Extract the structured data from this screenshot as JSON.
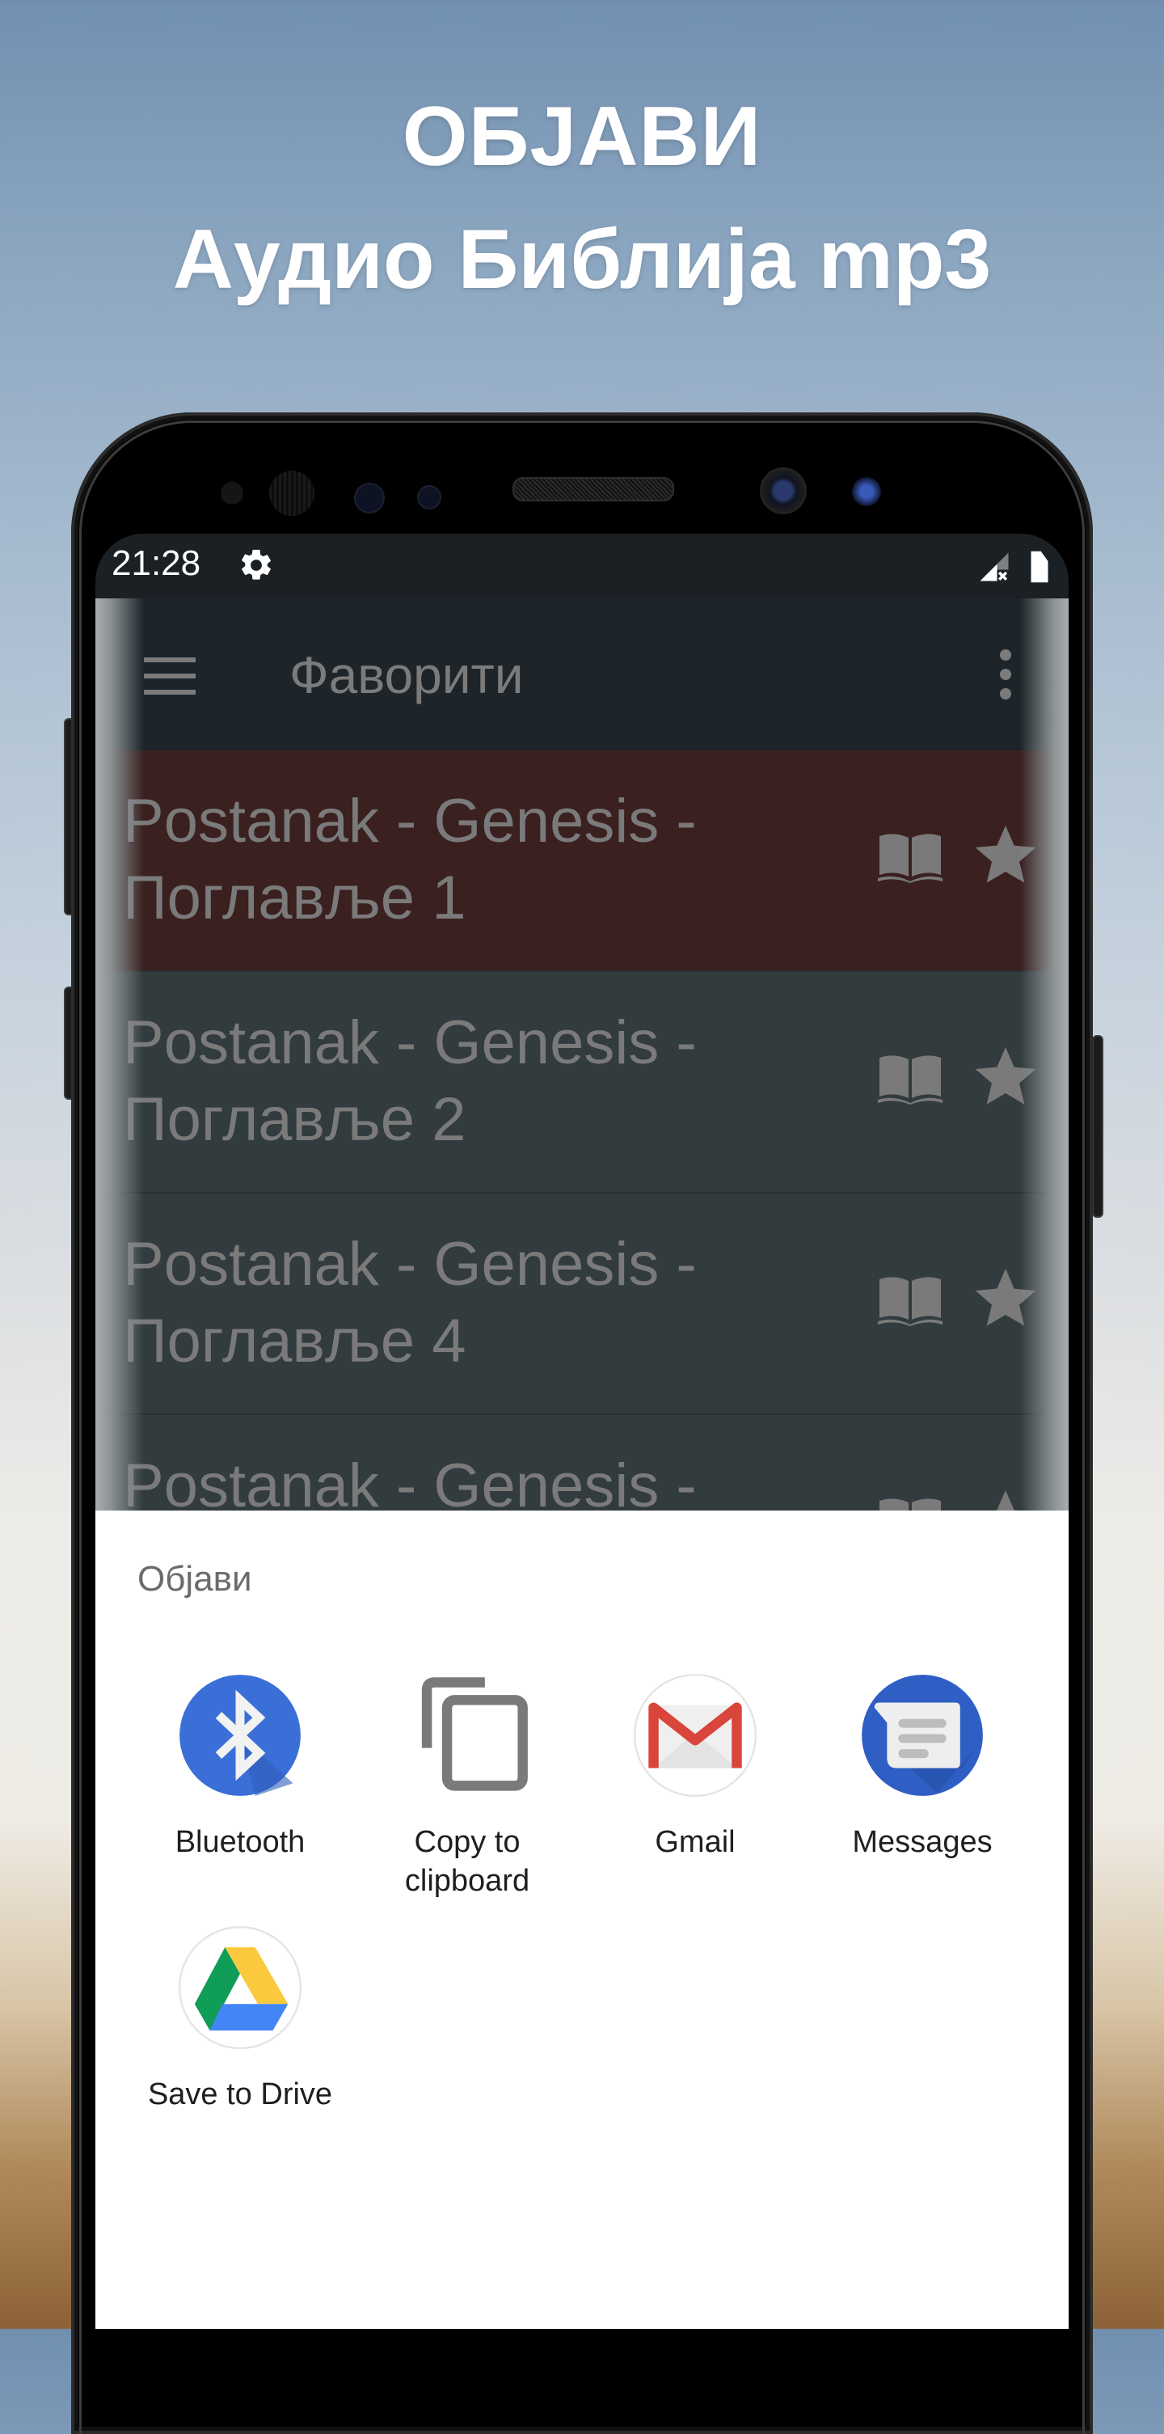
{
  "promo": {
    "line1": "ОБЈАВИ",
    "line2": "Аудио Библија mp3"
  },
  "status_bar": {
    "time": "21:28",
    "icons": [
      "settings-gear-icon",
      "signal-no-service-icon",
      "battery-icon"
    ]
  },
  "toolbar": {
    "title": "Фаворити",
    "menu_icon": "hamburger-menu-icon",
    "more_icon": "more-vert-icon"
  },
  "favorites": [
    {
      "line1": "Postanak - Genesis -",
      "line2": "Поглавље 1",
      "selected": true
    },
    {
      "line1": "Postanak - Genesis -",
      "line2": "Поглавље 2",
      "selected": false
    },
    {
      "line1": "Postanak - Genesis -",
      "line2": "Поглавље 4",
      "selected": false
    },
    {
      "line1": "Postanak - Genesis -",
      "line2": "",
      "selected": false
    }
  ],
  "share_sheet": {
    "title": "Објави",
    "targets": [
      {
        "label": "Bluetooth",
        "icon": "bluetooth-icon"
      },
      {
        "label": "Copy to clipboard",
        "icon": "copy-icon"
      },
      {
        "label": "Gmail",
        "icon": "gmail-icon"
      },
      {
        "label": "Messages",
        "icon": "messages-icon"
      },
      {
        "label": "Save to Drive",
        "icon": "google-drive-icon"
      }
    ]
  },
  "colors": {
    "selected_row": "#3a201f",
    "row": "#323b3e",
    "toolbar": "#1e252a",
    "bluetooth_blue": "#3b6fd8",
    "messages_blue": "#2f5ec4",
    "gmail_red": "#db4437"
  }
}
